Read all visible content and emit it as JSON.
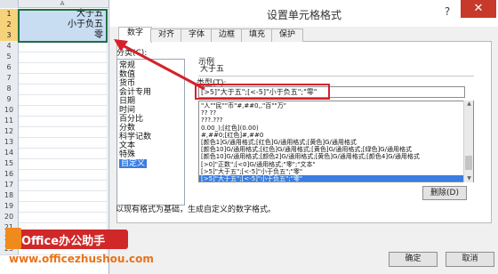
{
  "spreadsheet": {
    "column_header": "A",
    "rows": [
      {
        "num": "1",
        "value": "大于五",
        "selected": true
      },
      {
        "num": "2",
        "value": "小于负五",
        "selected": true
      },
      {
        "num": "3",
        "value": "零",
        "selected": true
      },
      {
        "num": "4",
        "value": ""
      },
      {
        "num": "5",
        "value": ""
      },
      {
        "num": "6",
        "value": ""
      },
      {
        "num": "7",
        "value": ""
      },
      {
        "num": "8",
        "value": ""
      },
      {
        "num": "9",
        "value": ""
      },
      {
        "num": "10",
        "value": ""
      },
      {
        "num": "11",
        "value": ""
      },
      {
        "num": "12",
        "value": ""
      },
      {
        "num": "13",
        "value": ""
      },
      {
        "num": "14",
        "value": ""
      },
      {
        "num": "15",
        "value": ""
      },
      {
        "num": "16",
        "value": ""
      },
      {
        "num": "17",
        "value": ""
      },
      {
        "num": "18",
        "value": ""
      },
      {
        "num": "19",
        "value": ""
      },
      {
        "num": "20",
        "value": ""
      },
      {
        "num": "21",
        "value": ""
      },
      {
        "num": "22",
        "value": ""
      },
      {
        "num": "23",
        "value": ""
      }
    ]
  },
  "dialog": {
    "title": "设置单元格格式",
    "help": "?",
    "close": "✕",
    "tabs": [
      "数字",
      "对齐",
      "字体",
      "边框",
      "填充",
      "保护"
    ],
    "category_label": "分类(C):",
    "categories": [
      "常规",
      "数值",
      "货币",
      "会计专用",
      "日期",
      "时间",
      "百分比",
      "分数",
      "科学记数",
      "文本",
      "特殊",
      "自定义"
    ],
    "selected_category": "自定义",
    "sample_label": "示例",
    "sample_value": "大于五",
    "type_label": "类型(T):",
    "type_value": "[>5]\"大于五\";[<-5]\"小于负五\";\"零\"",
    "formats": [
      "\"人\"\"民\"\"币\"#,##0,,\"百\"\"万\"",
      "?? ??",
      "???.???",
      "0.00_);[红色](0.00)",
      "#,##0;[红色]#,##0",
      "[颜色1]G/通用格式;[红色]G/通用格式;[黄色]G/通用格式",
      "[颜色10]G/通用格式;[红色]G/通用格式;[黄色]G/通用格式;[绿色]G/通用格式",
      "[颜色10]G/通用格式;[颜色2]G/通用格式;[黄色]G/通用格式;[颜色4]G/通用格式",
      "[>0]\"正数\";[<0]G/通用格式;\"零\";\"文本\"",
      "[>5]\"大于五\";[<-5]\"小于负五\";\"零\"",
      "[>5]\"大于五\";[<-5]\"小于负五\";\"零\""
    ],
    "selected_format_index": 10,
    "delete_button": "删除(D)",
    "description": "以现有格式为基础，生成自定义的数字格式。",
    "ok_button": "确定",
    "cancel_button": "取消"
  },
  "watermark": {
    "title": "Office办公助手",
    "url": "www.officezhushou.com"
  },
  "colors": {
    "selection_blue": "#3a7ee0",
    "highlight_red": "#d6202a",
    "close_red": "#c7392a",
    "cell_border_green": "#1f6e43"
  }
}
